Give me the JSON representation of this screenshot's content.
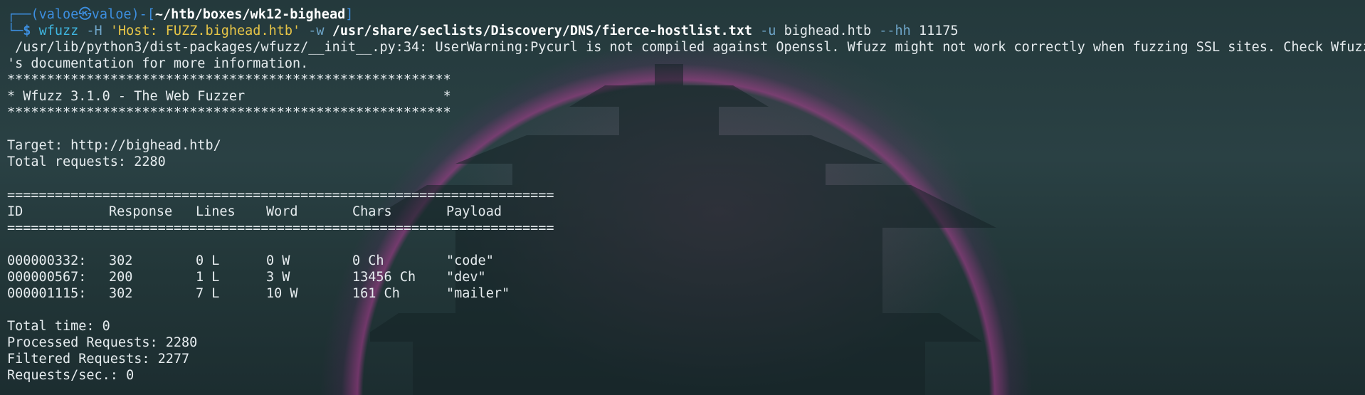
{
  "prompt": {
    "box_open": "┌──(",
    "user": "valoe",
    "at": "㉿",
    "host": "valoe",
    "mid": ")-[",
    "cwd": "~/htb/boxes/wk12-bighead",
    "close": "]",
    "prompt_prefix": "└─",
    "dollar": "$"
  },
  "command": {
    "program": "wfuzz",
    "flag_h": "-H",
    "header_value": "'Host: FUZZ.bighead.htb'",
    "flag_w": "-w",
    "wordlist": "/usr/share/seclists/Discovery/DNS/fierce-hostlist.txt",
    "flag_u": "-u",
    "url": "bighead.htb",
    "flag_hh": "--hh",
    "hh_value": "11175"
  },
  "output": {
    "warning_line1": " /usr/lib/python3/dist-packages/wfuzz/__init__.py:34: UserWarning:Pycurl is not compiled against Openssl. Wfuzz might not work correctly when fuzzing SSL sites. Check Wfuzz",
    "warning_line2": "'s documentation for more information.",
    "stars": "********************************************************",
    "banner": "* Wfuzz 3.1.0 - The Web Fuzzer                         *",
    "target": "Target: http://bighead.htb/",
    "total_requests": "Total requests: 2280",
    "separator": "=====================================================================",
    "columns": [
      "ID",
      "Response",
      "Lines",
      "Word",
      "Chars",
      "Payload"
    ],
    "rows": [
      [
        "000000332:",
        "302",
        "0 L",
        "0 W",
        "0 Ch",
        "\"code\""
      ],
      [
        "000000567:",
        "200",
        "1 L",
        "3 W",
        "13456 Ch",
        "\"dev\""
      ],
      [
        "000001115:",
        "302",
        "7 L",
        "10 W",
        "161 Ch",
        "\"mailer\""
      ]
    ],
    "total_time": "Total time: 0",
    "processed": "Processed Requests: 2280",
    "filtered": "Filtered Requests: 2277",
    "rate": "Requests/sec.: 0"
  }
}
